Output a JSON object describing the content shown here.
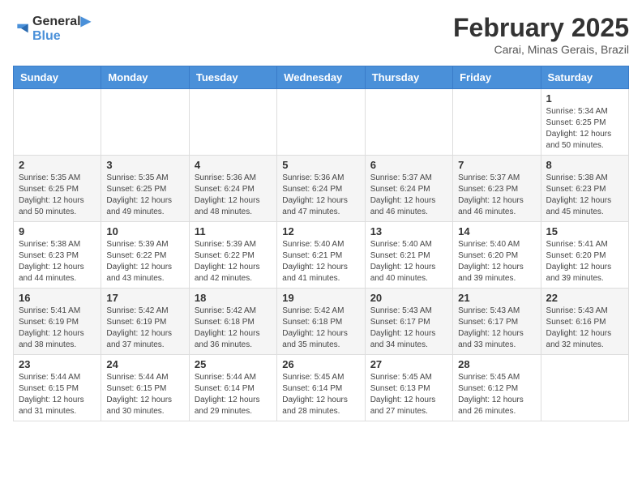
{
  "logo": {
    "line1": "General",
    "line2": "Blue"
  },
  "title": "February 2025",
  "location": "Carai, Minas Gerais, Brazil",
  "days_of_week": [
    "Sunday",
    "Monday",
    "Tuesday",
    "Wednesday",
    "Thursday",
    "Friday",
    "Saturday"
  ],
  "weeks": [
    [
      {
        "day": "",
        "info": ""
      },
      {
        "day": "",
        "info": ""
      },
      {
        "day": "",
        "info": ""
      },
      {
        "day": "",
        "info": ""
      },
      {
        "day": "",
        "info": ""
      },
      {
        "day": "",
        "info": ""
      },
      {
        "day": "1",
        "info": "Sunrise: 5:34 AM\nSunset: 6:25 PM\nDaylight: 12 hours\nand 50 minutes."
      }
    ],
    [
      {
        "day": "2",
        "info": "Sunrise: 5:35 AM\nSunset: 6:25 PM\nDaylight: 12 hours\nand 50 minutes."
      },
      {
        "day": "3",
        "info": "Sunrise: 5:35 AM\nSunset: 6:25 PM\nDaylight: 12 hours\nand 49 minutes."
      },
      {
        "day": "4",
        "info": "Sunrise: 5:36 AM\nSunset: 6:24 PM\nDaylight: 12 hours\nand 48 minutes."
      },
      {
        "day": "5",
        "info": "Sunrise: 5:36 AM\nSunset: 6:24 PM\nDaylight: 12 hours\nand 47 minutes."
      },
      {
        "day": "6",
        "info": "Sunrise: 5:37 AM\nSunset: 6:24 PM\nDaylight: 12 hours\nand 46 minutes."
      },
      {
        "day": "7",
        "info": "Sunrise: 5:37 AM\nSunset: 6:23 PM\nDaylight: 12 hours\nand 46 minutes."
      },
      {
        "day": "8",
        "info": "Sunrise: 5:38 AM\nSunset: 6:23 PM\nDaylight: 12 hours\nand 45 minutes."
      }
    ],
    [
      {
        "day": "9",
        "info": "Sunrise: 5:38 AM\nSunset: 6:23 PM\nDaylight: 12 hours\nand 44 minutes."
      },
      {
        "day": "10",
        "info": "Sunrise: 5:39 AM\nSunset: 6:22 PM\nDaylight: 12 hours\nand 43 minutes."
      },
      {
        "day": "11",
        "info": "Sunrise: 5:39 AM\nSunset: 6:22 PM\nDaylight: 12 hours\nand 42 minutes."
      },
      {
        "day": "12",
        "info": "Sunrise: 5:40 AM\nSunset: 6:21 PM\nDaylight: 12 hours\nand 41 minutes."
      },
      {
        "day": "13",
        "info": "Sunrise: 5:40 AM\nSunset: 6:21 PM\nDaylight: 12 hours\nand 40 minutes."
      },
      {
        "day": "14",
        "info": "Sunrise: 5:40 AM\nSunset: 6:20 PM\nDaylight: 12 hours\nand 39 minutes."
      },
      {
        "day": "15",
        "info": "Sunrise: 5:41 AM\nSunset: 6:20 PM\nDaylight: 12 hours\nand 39 minutes."
      }
    ],
    [
      {
        "day": "16",
        "info": "Sunrise: 5:41 AM\nSunset: 6:19 PM\nDaylight: 12 hours\nand 38 minutes."
      },
      {
        "day": "17",
        "info": "Sunrise: 5:42 AM\nSunset: 6:19 PM\nDaylight: 12 hours\nand 37 minutes."
      },
      {
        "day": "18",
        "info": "Sunrise: 5:42 AM\nSunset: 6:18 PM\nDaylight: 12 hours\nand 36 minutes."
      },
      {
        "day": "19",
        "info": "Sunrise: 5:42 AM\nSunset: 6:18 PM\nDaylight: 12 hours\nand 35 minutes."
      },
      {
        "day": "20",
        "info": "Sunrise: 5:43 AM\nSunset: 6:17 PM\nDaylight: 12 hours\nand 34 minutes."
      },
      {
        "day": "21",
        "info": "Sunrise: 5:43 AM\nSunset: 6:17 PM\nDaylight: 12 hours\nand 33 minutes."
      },
      {
        "day": "22",
        "info": "Sunrise: 5:43 AM\nSunset: 6:16 PM\nDaylight: 12 hours\nand 32 minutes."
      }
    ],
    [
      {
        "day": "23",
        "info": "Sunrise: 5:44 AM\nSunset: 6:15 PM\nDaylight: 12 hours\nand 31 minutes."
      },
      {
        "day": "24",
        "info": "Sunrise: 5:44 AM\nSunset: 6:15 PM\nDaylight: 12 hours\nand 30 minutes."
      },
      {
        "day": "25",
        "info": "Sunrise: 5:44 AM\nSunset: 6:14 PM\nDaylight: 12 hours\nand 29 minutes."
      },
      {
        "day": "26",
        "info": "Sunrise: 5:45 AM\nSunset: 6:14 PM\nDaylight: 12 hours\nand 28 minutes."
      },
      {
        "day": "27",
        "info": "Sunrise: 5:45 AM\nSunset: 6:13 PM\nDaylight: 12 hours\nand 27 minutes."
      },
      {
        "day": "28",
        "info": "Sunrise: 5:45 AM\nSunset: 6:12 PM\nDaylight: 12 hours\nand 26 minutes."
      },
      {
        "day": "",
        "info": ""
      }
    ]
  ]
}
